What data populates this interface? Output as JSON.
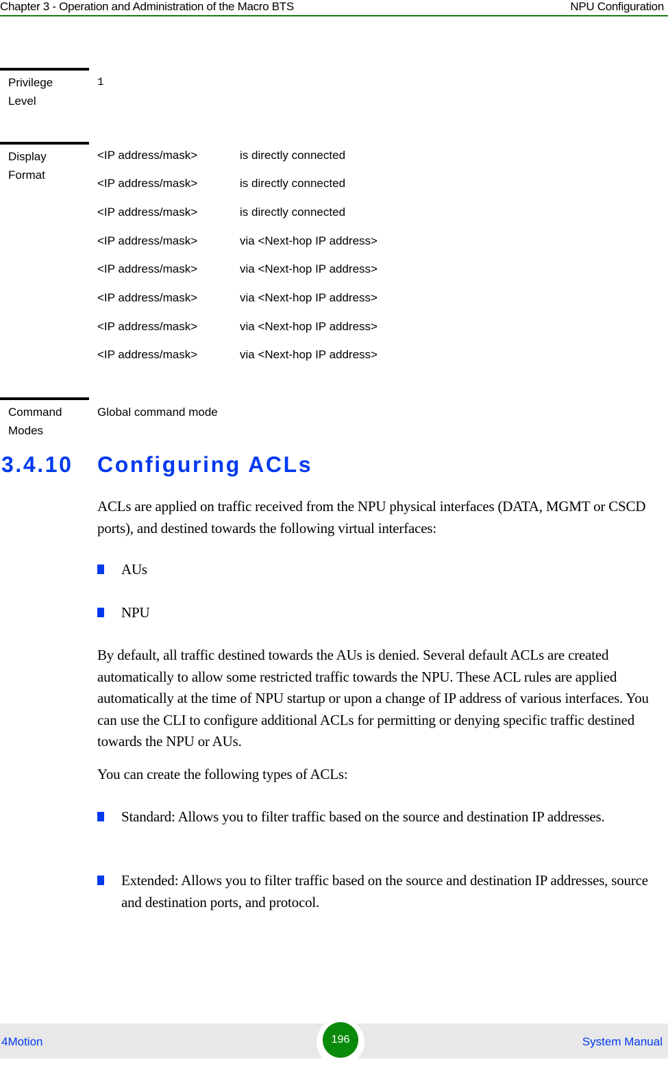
{
  "header": {
    "chapter": "Chapter 3 - Operation and Administration of the Macro BTS",
    "section": "NPU Configuration"
  },
  "command_table": {
    "privilege": {
      "label": "Privilege Level",
      "value": "1"
    },
    "display_format": {
      "label": "Display Format",
      "lines": [
        {
          "address": "<IP address/mask>",
          "route": "is directly connected"
        },
        {
          "address": "<IP address/mask>",
          "route": "is directly connected"
        },
        {
          "address": "<IP address/mask>",
          "route": "is directly connected"
        },
        {
          "address": "<IP address/mask>",
          "route": "via <Next-hop IP address>"
        },
        {
          "address": "<IP address/mask>",
          "route": "via <Next-hop IP address>"
        },
        {
          "address": "<IP address/mask>",
          "route": "via <Next-hop IP address>"
        },
        {
          "address": "<IP address/mask>",
          "route": "via <Next-hop IP address>"
        },
        {
          "address": "<IP address/mask>",
          "route": "via <Next-hop IP address>"
        }
      ]
    },
    "command_modes": {
      "label": "Command Modes",
      "value": "Global command mode"
    }
  },
  "section": {
    "number": "3.4.10",
    "title": "Configuring ACLs",
    "intro": "ACLs are applied on traffic received from the NPU physical interfaces (DATA, MGMT or CSCD ports), and destined towards the following virtual interfaces:",
    "interfaces": [
      "AUs",
      "NPU"
    ],
    "paragraph": "By default, all traffic destined towards the AUs is denied. Several default ACLs are created automatically to allow some restricted traffic towards the NPU. These ACL rules are applied automatically at the time of NPU startup or upon a change of IP address of various interfaces. You can use the CLI to configure additional ACLs for permitting or denying specific traffic destined towards the NPU or AUs.",
    "types_intro": "You can create the following types of ACLs:",
    "types": [
      "Standard: Allows you to filter traffic based on the source and destination IP addresses.",
      "Extended: Allows you to filter traffic based on the source and destination IP addresses, source and destination ports, and protocol."
    ]
  },
  "footer": {
    "product": "4Motion",
    "page_number": "196",
    "document": "System Manual"
  },
  "colors": {
    "header_rule": "#108010",
    "heading_blue": "#0039f0",
    "bullet_blue": "#0039f0",
    "page_badge_green": "#0a8a0a",
    "footer_bg": "#e8e8e8"
  }
}
